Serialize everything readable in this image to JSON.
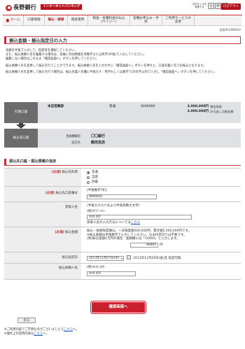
{
  "header": {
    "bank_name": "長野銀行",
    "ib_badge": "インターネットバンキング",
    "font_size_label": "文字サイズを変更する",
    "font_small": "小",
    "font_medium": "中",
    "font_large": "大",
    "logout": "ログアウト"
  },
  "nav": {
    "home": "ホーム",
    "items": [
      "口座情報",
      "振込・振替",
      "資産運用",
      "税金・各種料金の払込(ペイジー)",
      "各種お申込み・手続",
      "ご利用サービスの変更"
    ]
  },
  "screen_id": "画面ID:EIBK002",
  "page_title": "振込金額・振込指定日の入力",
  "intro": {
    "p1a": "金額を半角で入力して、指定日を選択してください。",
    "p1b": "また、振込依頼人名を編集する場合は、前後に付加情報を英数字または英字(半角)で入力してください。",
    "p1c": "編集しない場合はこのまま「確認画面へ」ボタンを押してください。",
    "p2": "振込依頼人名を変更して振込を行うことができます。振込依頼人名を入力せずに「確認画面へ」ボタンを押すと、口座名義人名でお振込となります。",
    "p3": "振込依頼人名を変更して振込を行う場合は、振込名義人名欄に半角カナ、英字もしくは数字で20文字以内で入力し「確認画面へ」ボタンを押してください。"
  },
  "transfer": {
    "from_label": "引落口座",
    "to_label": "振込先口座",
    "from_branch": "本店営業部",
    "from_type": "普通",
    "from_number": "0000000",
    "balance_amount": "3,000,000円",
    "balance_label": "預金残高",
    "available_amount": "3,000,000円",
    "available_label": "お引出し可能金額",
    "bank_label": "金融機関名",
    "bank_value": "〇〇銀行",
    "branch_label": "支店名",
    "branch_value": "飯田支店"
  },
  "section_title": "振込先口座・振込情報の指定",
  "form": {
    "subject_label": "振込先科目",
    "subject_req": "[必須]",
    "subject_options": [
      "普通",
      "当座",
      "貯蓄"
    ],
    "account_label": "振込先口座番号",
    "account_req": "[必須]",
    "account_hint": "(半角数字7桁)",
    "account_value": "9900001",
    "recipient_label": "受取人名",
    "recipient_hint": "(半角カタカナおよび半角英数大文字)",
    "recipient_prefix": "(例)ｳｹﾄﾘ ﾊﾅｺ",
    "recipient_value": "ﾏﾙﾏﾙ ﾀﾛｳ",
    "recipient_note": "受取人名の入力方法については",
    "recipient_note_link": "こちら",
    "amount_label": "振込金額",
    "amount_req": "[必須]",
    "amount_note1": "振込・振替限度額は、一日限度額200,000円、累計額5,000,000円です。",
    "amount_note2": "※振込金額は半角数字で入力してください。なお桁区切りは不要です。",
    "amount_note3": "(例)振込金額1万円の場合　金額欄には「10000」と入力します。",
    "amount_value": "90000",
    "amount_unit": "円",
    "date_label": "振込指定日",
    "date_value": "2013年11月27日(水)",
    "date_note": "2013年11月29日(金)迄 指定可能",
    "requester_label": "振込依頼人名",
    "requester_example": "(例)ﾏﾙﾏﾙ ﾀﾛｳ",
    "requester_value": "ﾏﾙﾏﾙ ﾀﾛｳ"
  },
  "buttons": {
    "confirm": "確認画面へ",
    "back": "戻る"
  },
  "footer": {
    "line1": "※ご利用内容でご不明な点がございましたら",
    "line1_link": "こちら",
    "line1_end": "へ。",
    "line2": "※操作上の説明内容は",
    "line2_link": "こちら",
    "line2_end": "へ。"
  },
  "colors": {
    "brand_red": "#c43238",
    "button_red": "#c8202f",
    "panel_gray": "#dfe1e4",
    "tab_gray": "#6c6c6c"
  }
}
